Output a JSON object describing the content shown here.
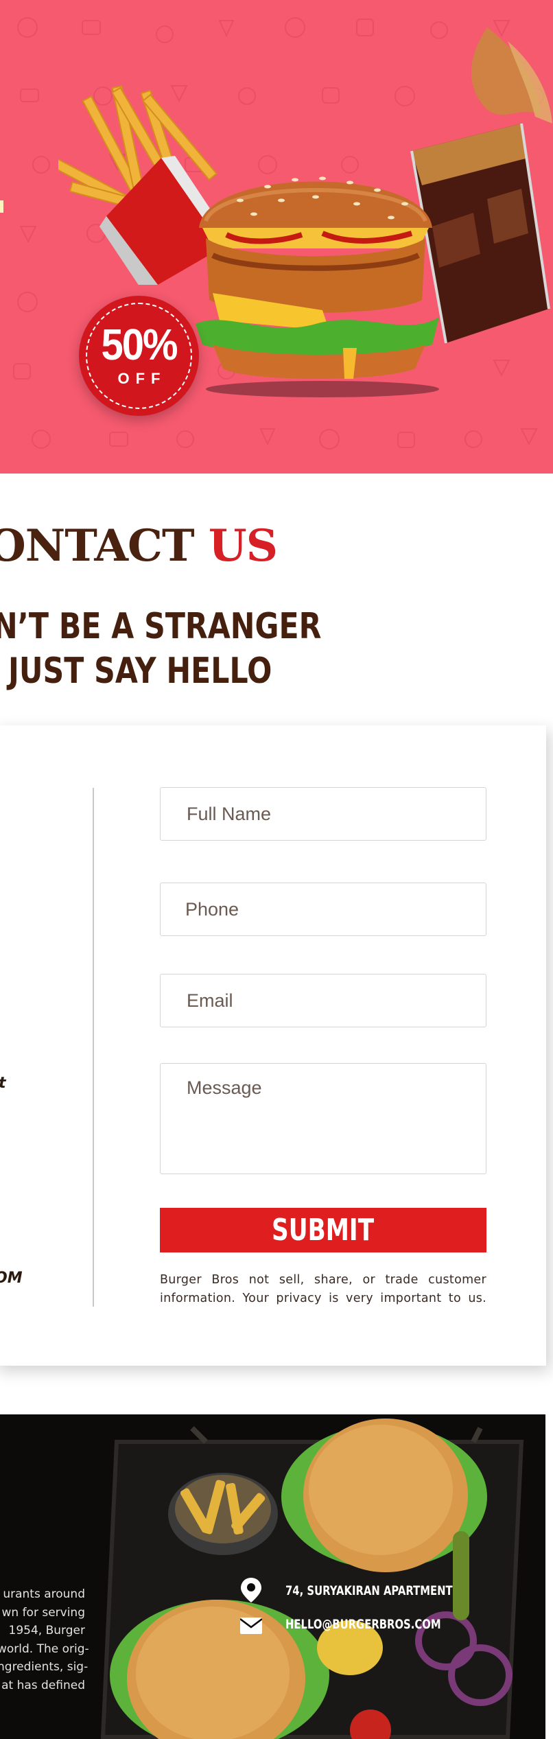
{
  "hero": {
    "promo": {
      "value": "50%",
      "unit": "OFF"
    }
  },
  "contact": {
    "title_main": "ONTACT",
    "title_accent": "US",
    "tagline_line1": "N’T BE A STRANGER",
    "tagline_line2": "JUST SAY HELLO"
  },
  "form": {
    "name_placeholder": "Full Name",
    "phone_placeholder": "Phone",
    "email_placeholder": "Email",
    "message_placeholder": "Message",
    "submit_label": "SUBMIT",
    "privacy_text": "Burger Bros not sell, share, or trade customer information. Your privacy is very important to us.",
    "left_fragment_1": "t",
    "left_fragment_2": "OM"
  },
  "footer": {
    "about_lines": [
      "urants around",
      "wn for serving",
      "1954, Burger",
      "world. The orig-",
      "ngredients, sig-",
      "at has defined"
    ],
    "address": "74, SURYAKIRAN APARTMENT",
    "email": "HELLO@BURGERBROS.COM",
    "address_icon": "map-pin-icon",
    "email_icon": "envelope-icon"
  },
  "colors": {
    "hero_background": "#f65a6f",
    "brand_brown": "#4a2210",
    "brand_red": "#d71f26",
    "submit_red": "#df1f1f",
    "footer_background": "#0d0b0a"
  }
}
